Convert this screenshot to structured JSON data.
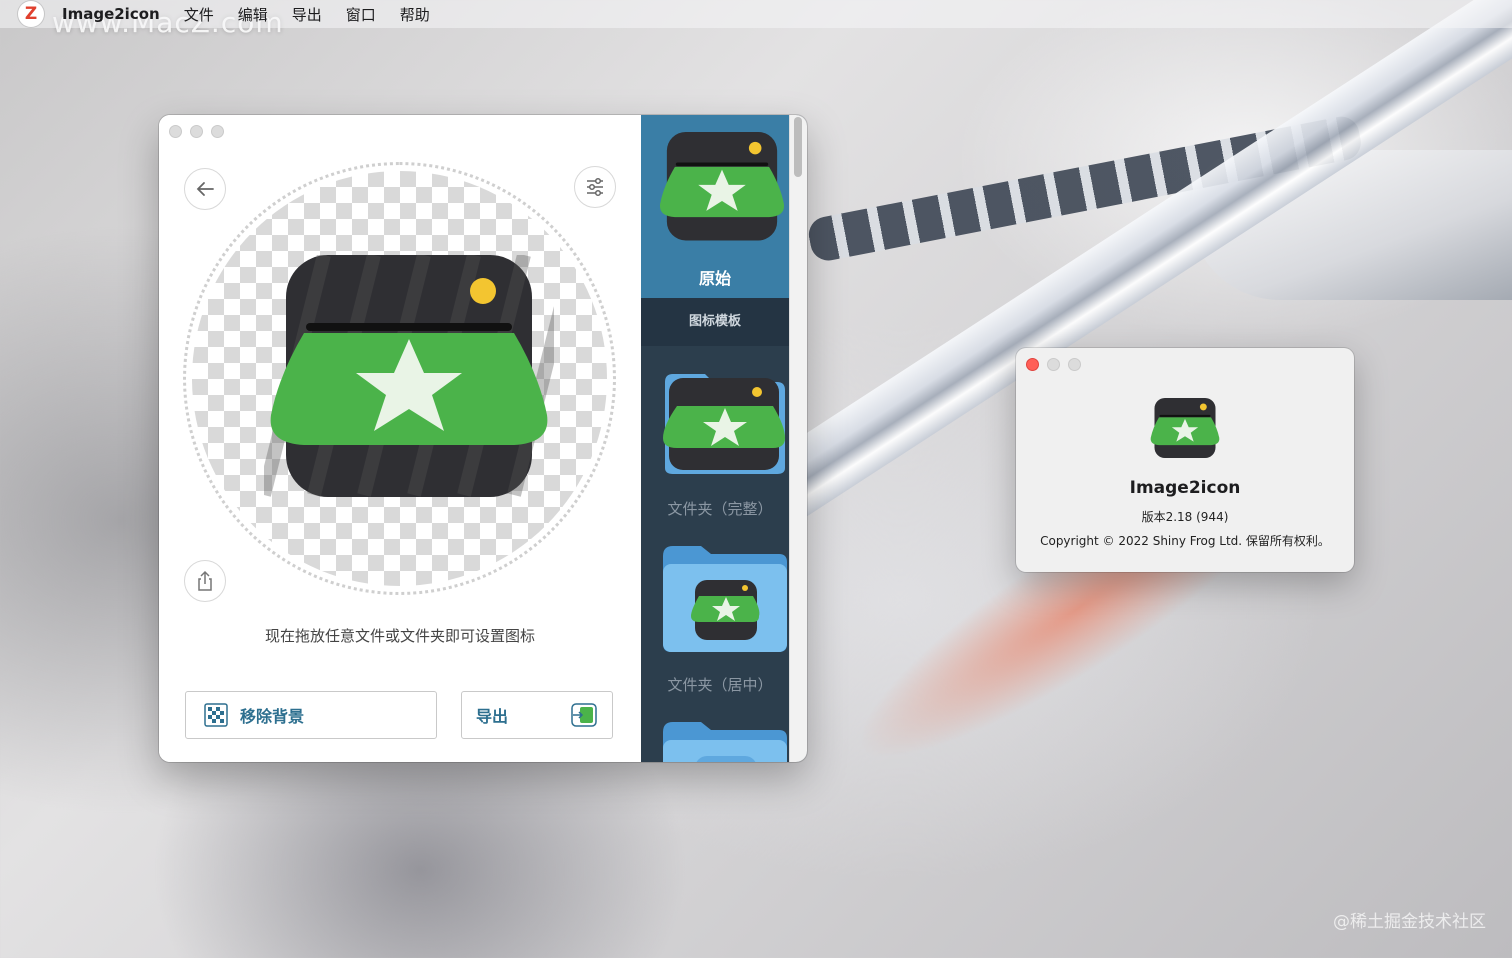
{
  "menubar": {
    "app_icon": "Z",
    "app_name": "Image2icon",
    "items": [
      "文件",
      "编辑",
      "导出",
      "窗口",
      "帮助"
    ]
  },
  "wallpaper": {
    "watermark": "www.MacZ.com",
    "corner_watermark": "@稀土掘金技术社区"
  },
  "main_window": {
    "drop_hint": "现在拖放任意文件或文件夹即可设置图标",
    "remove_bg_label": "移除背景",
    "export_label": "导出",
    "templates": {
      "original_label": "原始",
      "section_label": "图标模板",
      "items": [
        "文件夹（完整）",
        "文件夹（居中）"
      ]
    },
    "icons": {
      "back": "arrow-left-icon",
      "settings": "sliders-icon",
      "share": "share-icon",
      "remove_bg": "checker-image-icon",
      "export": "export-icon"
    }
  },
  "about_window": {
    "app_name": "Image2icon",
    "version": "版本2.18 (944)",
    "copyright": "Copyright © 2022 Shiny Frog Ltd. 保留所有权利。"
  },
  "colors": {
    "accent": "#2d6f8f",
    "sidebar_bg": "#2c3e4d",
    "sidebar_selected": "#3a7ea6",
    "icon_green": "#4bb34a",
    "icon_yellow": "#f3c530"
  }
}
